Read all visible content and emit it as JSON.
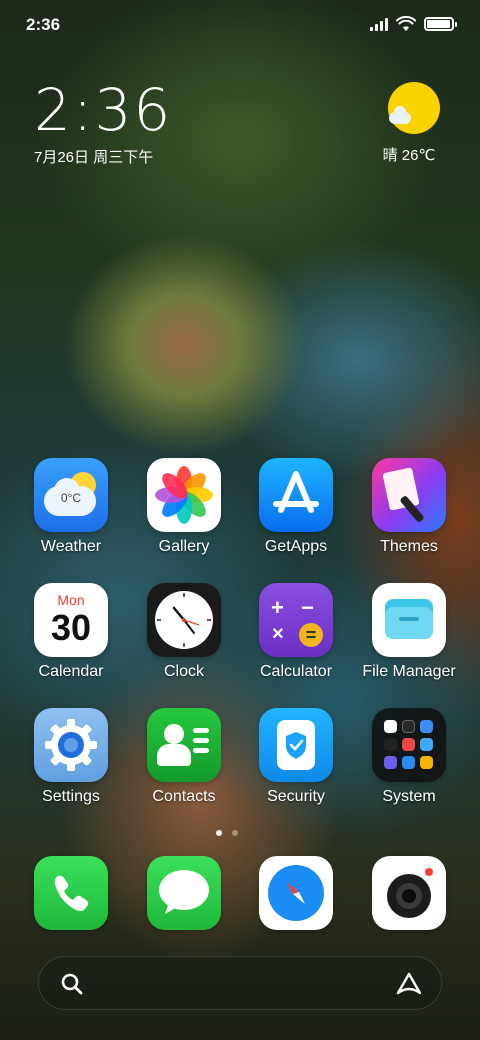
{
  "status_bar": {
    "time": "2:36",
    "icons": [
      "signal-icon",
      "wifi-icon",
      "battery-icon"
    ],
    "battery_level": 0.95
  },
  "clock_widget": {
    "time": "2:36",
    "date": "7月26日 周三下午"
  },
  "weather_widget": {
    "condition_icon": "sunny-cloud-icon",
    "text": "晴 26℃"
  },
  "apps": [
    {
      "label": "Weather",
      "icon": "weather-icon",
      "temp": "0°C"
    },
    {
      "label": "Gallery",
      "icon": "gallery-icon"
    },
    {
      "label": "GetApps",
      "icon": "getapps-icon"
    },
    {
      "label": "Themes",
      "icon": "themes-icon"
    },
    {
      "label": "Calendar",
      "icon": "calendar-icon",
      "month": "Mon",
      "day": "30"
    },
    {
      "label": "Clock",
      "icon": "clock-icon"
    },
    {
      "label": "Calculator",
      "icon": "calculator-icon"
    },
    {
      "label": "File Manager",
      "icon": "file-manager-icon"
    },
    {
      "label": "Settings",
      "icon": "settings-icon"
    },
    {
      "label": "Contacts",
      "icon": "contacts-icon"
    },
    {
      "label": "Security",
      "icon": "security-icon"
    },
    {
      "label": "System",
      "icon": "system-folder-icon"
    }
  ],
  "page_indicator": {
    "pages": 2,
    "active": 0
  },
  "dock": [
    {
      "icon": "phone-icon"
    },
    {
      "icon": "messages-icon"
    },
    {
      "icon": "browser-icon"
    },
    {
      "icon": "camera-icon"
    }
  ],
  "search_bar": {
    "left_icon": "search-icon",
    "right_icon": "assistant-icon"
  },
  "colors": {
    "weather_sun": "#f8d300",
    "phone_green": "#2ecc40",
    "calc_purple": "#7b3fd1",
    "security_blue": "#1aa3ff"
  }
}
